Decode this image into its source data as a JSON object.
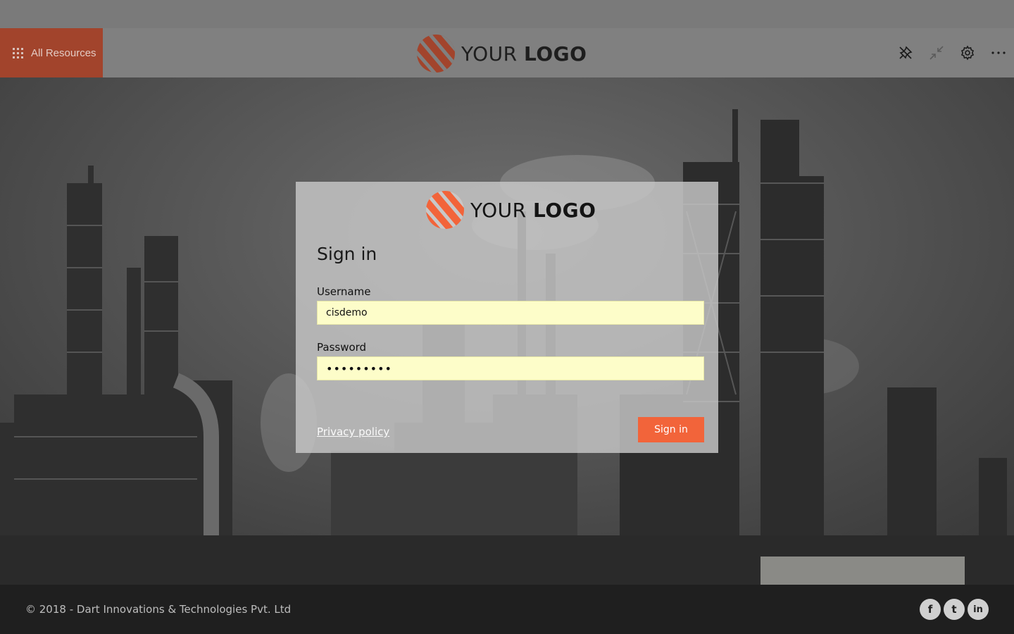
{
  "header": {
    "all_resources_label": "All Resources",
    "logo_text_light": "YOUR ",
    "logo_text_bold": "LOGO",
    "actions": [
      {
        "name": "pin-icon"
      },
      {
        "name": "collapse-icon"
      },
      {
        "name": "gear-icon"
      },
      {
        "name": "more-icon"
      }
    ]
  },
  "signin": {
    "logo_text_light": "YOUR ",
    "logo_text_bold": "LOGO",
    "title": "Sign in",
    "username_label": "Username",
    "username_value": "cisdemo",
    "password_label": "Password",
    "password_value": "•••••••••",
    "privacy_label": "Privacy policy",
    "signin_button_label": "Sign in"
  },
  "footer": {
    "copyright": "© 2018 - Dart Innovations & Technologies Pvt. Ltd",
    "social": [
      {
        "icon": "facebook-icon",
        "glyph": "f"
      },
      {
        "icon": "twitter-icon",
        "glyph": "t"
      },
      {
        "icon": "linkedin-icon",
        "glyph": "in"
      }
    ]
  },
  "colors": {
    "accent": "#f2643a",
    "all_resources_bg": "#a2442c",
    "input_bg": "#fdfdc9"
  }
}
